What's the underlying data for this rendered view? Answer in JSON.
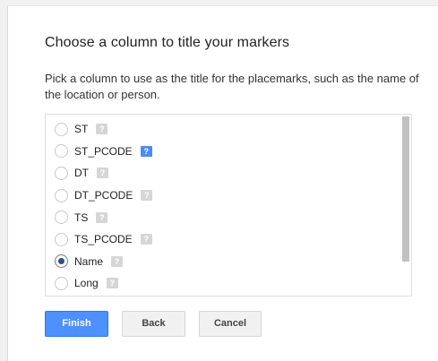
{
  "dialog": {
    "title": "Choose a column to title your markers",
    "description": "Pick a column to use as the title for the placemarks, such as the name of the location or person."
  },
  "columns": [
    {
      "label": "ST",
      "checked": false,
      "help_active": false
    },
    {
      "label": "ST_PCODE",
      "checked": false,
      "help_active": true
    },
    {
      "label": "DT",
      "checked": false,
      "help_active": false
    },
    {
      "label": "DT_PCODE",
      "checked": false,
      "help_active": false
    },
    {
      "label": "TS",
      "checked": false,
      "help_active": false
    },
    {
      "label": "TS_PCODE",
      "checked": false,
      "help_active": false
    },
    {
      "label": "Name",
      "checked": true,
      "help_active": false
    },
    {
      "label": "Long",
      "checked": false,
      "help_active": false
    }
  ],
  "help_glyph": "?",
  "buttons": {
    "finish": "Finish",
    "back": "Back",
    "cancel": "Cancel"
  },
  "colors": {
    "primary": "#4d90fe",
    "help_active": "#4a8bf5",
    "help_inactive": "#d6d6d6"
  },
  "icons": {
    "radio": "radio-icon",
    "help": "help-icon"
  }
}
